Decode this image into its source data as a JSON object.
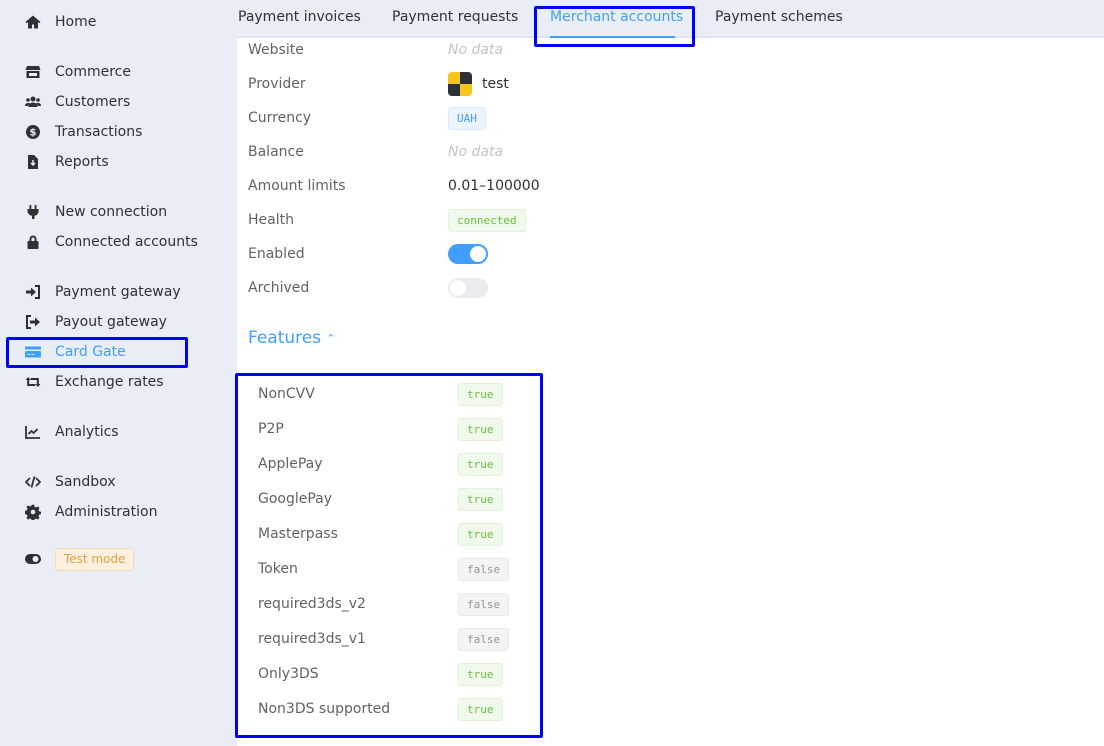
{
  "sidebar": {
    "items": [
      {
        "label": "Home",
        "icon": "home-icon"
      },
      {
        "label": "Commerce",
        "icon": "store-icon"
      },
      {
        "label": "Customers",
        "icon": "users-icon"
      },
      {
        "label": "Transactions",
        "icon": "dollar-circle-icon"
      },
      {
        "label": "Reports",
        "icon": "file-download-icon"
      },
      {
        "label": "New connection",
        "icon": "plug-icon"
      },
      {
        "label": "Connected accounts",
        "icon": "lock-icon"
      },
      {
        "label": "Payment gateway",
        "icon": "sign-in-icon"
      },
      {
        "label": "Payout gateway",
        "icon": "sign-out-icon"
      },
      {
        "label": "Card Gate",
        "icon": "credit-card-icon",
        "active": true
      },
      {
        "label": "Exchange rates",
        "icon": "retweet-icon"
      },
      {
        "label": "Analytics",
        "icon": "chart-line-icon"
      },
      {
        "label": "Sandbox",
        "icon": "code-icon"
      },
      {
        "label": "Administration",
        "icon": "gear-icon"
      }
    ],
    "test_mode": {
      "label": "Test mode",
      "icon": "toggle-icon"
    }
  },
  "tabs": [
    {
      "label": "Payment invoices"
    },
    {
      "label": "Payment requests"
    },
    {
      "label": "Merchant accounts",
      "active": true
    },
    {
      "label": "Payment schemes"
    }
  ],
  "details": {
    "website": {
      "label": "Website",
      "value": "No data"
    },
    "provider": {
      "label": "Provider",
      "value": "test"
    },
    "currency": {
      "label": "Currency",
      "value": "UAH"
    },
    "balance": {
      "label": "Balance",
      "value": "No data"
    },
    "amount_limits": {
      "label": "Amount limits",
      "value": "0.01–100000"
    },
    "health": {
      "label": "Health",
      "value": "connected"
    },
    "enabled": {
      "label": "Enabled",
      "value": true
    },
    "archived": {
      "label": "Archived",
      "value": false
    }
  },
  "features": {
    "title": "Features",
    "items": [
      {
        "name": "NonCVV",
        "value": "true"
      },
      {
        "name": "P2P",
        "value": "true"
      },
      {
        "name": "ApplePay",
        "value": "true"
      },
      {
        "name": "GooglePay",
        "value": "true"
      },
      {
        "name": "Masterpass",
        "value": "true"
      },
      {
        "name": "Token",
        "value": "false"
      },
      {
        "name": "required3ds_v2",
        "value": "false"
      },
      {
        "name": "required3ds_v1",
        "value": "false"
      },
      {
        "name": "Only3DS",
        "value": "true"
      },
      {
        "name": "Non3DS supported",
        "value": "true"
      }
    ]
  },
  "colors": {
    "accent": "#409eff",
    "success": "#67c23a",
    "warning": "#e6a23c",
    "annotation": "#0000ff"
  }
}
